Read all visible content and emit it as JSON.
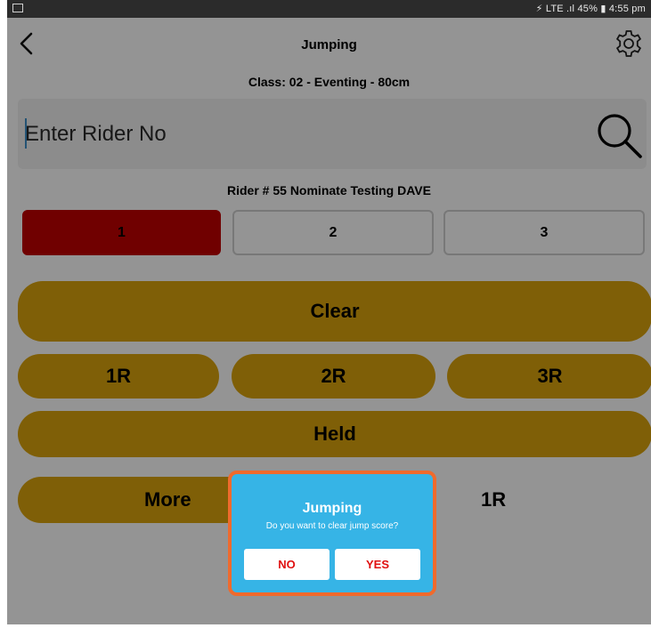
{
  "status_bar": {
    "right_text": "⚡ LTE .ıl 45% ▮ 4:55 pm"
  },
  "header": {
    "title": "Jumping"
  },
  "class_label": "Class: 02 - Eventing - 80cm",
  "search": {
    "placeholder": "Enter Rider No",
    "value": ""
  },
  "rider_label": "Rider # 55 Nominate Testing DAVE",
  "jump_tabs": [
    {
      "label": "1",
      "active": true
    },
    {
      "label": "2",
      "active": false
    },
    {
      "label": "3",
      "active": false
    }
  ],
  "score_buttons": {
    "clear": "Clear",
    "r1": "1R",
    "r2": "2R",
    "r3": "3R",
    "held": "Held",
    "more": "More",
    "selected": "1R"
  },
  "dialog": {
    "title": "Jumping",
    "message": "Do you want to clear jump score?",
    "no_label": "NO",
    "yes_label": "YES"
  },
  "colors": {
    "accent_gold": "#dba40d",
    "active_red": "#c20000",
    "dialog_blue": "#36b4e6",
    "dialog_border": "#f06a2c",
    "dialog_button_text": "#e01010"
  },
  "icons": [
    "back-arrow-icon",
    "gear-icon",
    "search-icon",
    "image-icon",
    "battery-icon"
  ]
}
